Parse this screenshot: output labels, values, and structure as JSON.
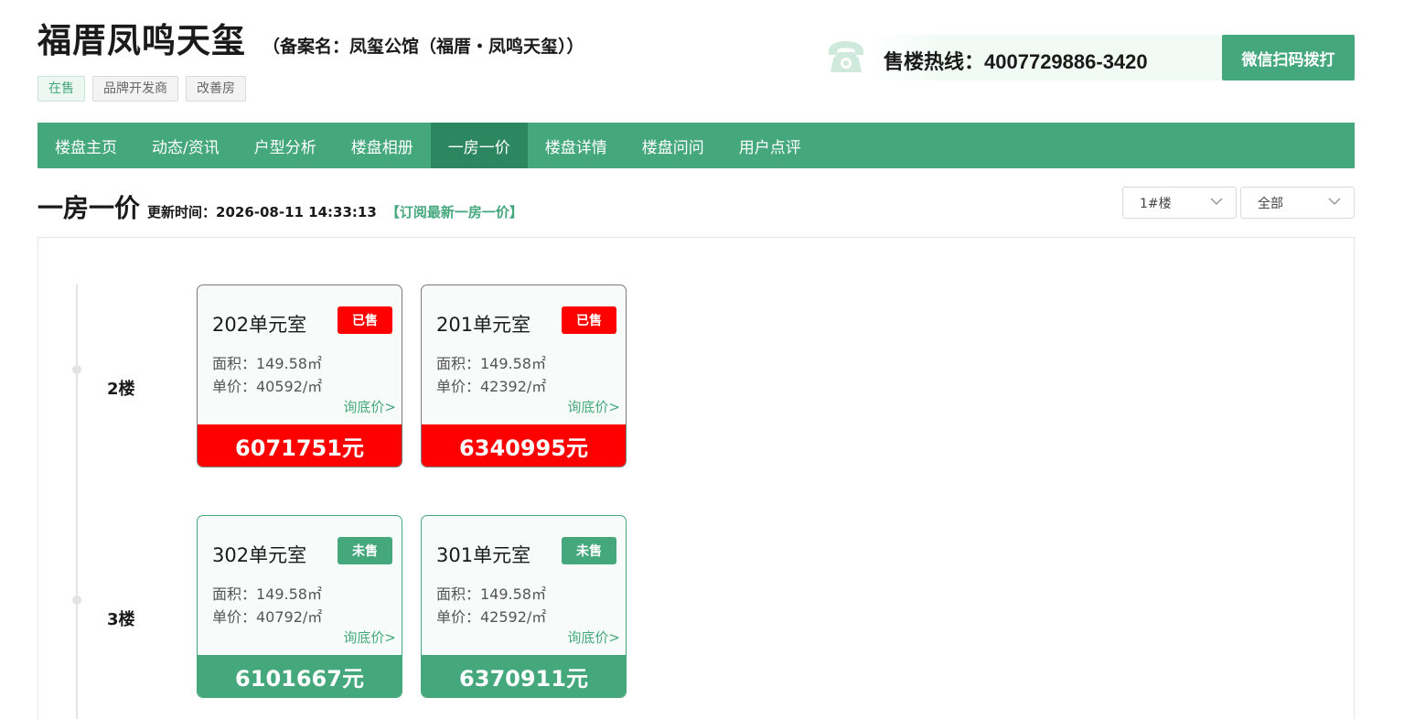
{
  "header": {
    "title": "福厝凤鸣天玺",
    "record_name": "（备案名：凤玺公馆（福厝・凤鸣天玺））",
    "tags": [
      "在售",
      "品牌开发商",
      "改善房"
    ],
    "hotline_label": "售楼热线：",
    "hotline_number": "4007729886-3420",
    "wechat_button": "微信扫码拨打",
    "phone_icon": "phone-icon"
  },
  "nav": {
    "items": [
      "楼盘主页",
      "动态/资讯",
      "户型分析",
      "楼盘相册",
      "一房一价",
      "楼盘详情",
      "楼盘问问",
      "用户点评"
    ],
    "active": "一房一价"
  },
  "section": {
    "title": "一房一价",
    "update_label": "更新时间：2026-08-11 14:33:13",
    "subscribe_link": "【订阅最新一房一价】",
    "filters": {
      "building": "1#楼",
      "status": "全部"
    }
  },
  "floors": [
    {
      "label": "2楼",
      "units": [
        {
          "name": "202单元室",
          "status": "已售",
          "area": "面积：149.58㎡",
          "unit_price": "单价：40592/㎡",
          "inquire": "询底价>",
          "total": "6071751元"
        },
        {
          "name": "201单元室",
          "status": "已售",
          "area": "面积：149.58㎡",
          "unit_price": "单价：42392/㎡",
          "inquire": "询底价>",
          "total": "6340995元"
        }
      ]
    },
    {
      "label": "3楼",
      "units": [
        {
          "name": "302单元室",
          "status": "未售",
          "area": "面积：149.58㎡",
          "unit_price": "单价：40792/㎡",
          "inquire": "询底价>",
          "total": "6101667元"
        },
        {
          "name": "301单元室",
          "status": "未售",
          "area": "面积：149.58㎡",
          "unit_price": "单价：42592/㎡",
          "inquire": "询底价>",
          "total": "6370911元"
        }
      ]
    }
  ],
  "colors": {
    "brand_green": "#45a87d",
    "nav_active": "#2c8760",
    "sold_red": "#ff0000"
  }
}
